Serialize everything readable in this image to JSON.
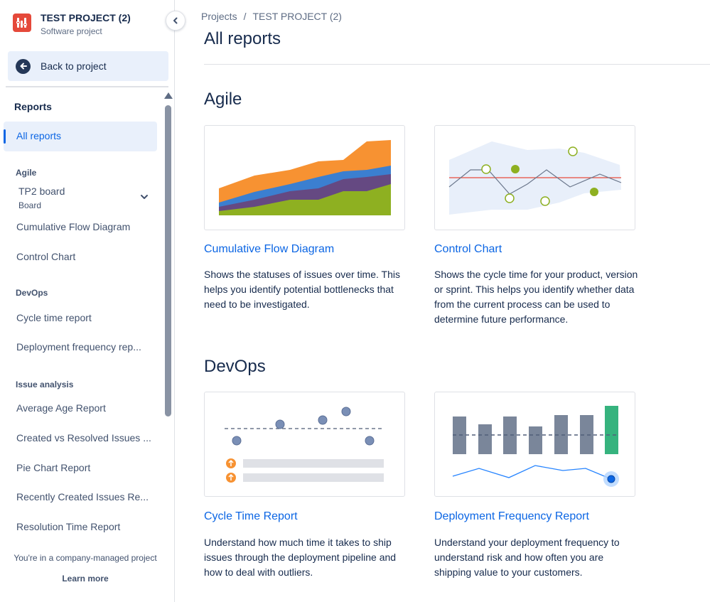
{
  "project": {
    "name": "TEST PROJECT (2)",
    "type": "Software project",
    "logo_color": "#e5493a"
  },
  "sidebar": {
    "back_label": "Back to project",
    "heading": "Reports",
    "active_item": "All reports",
    "groups": {
      "agile": "Agile",
      "devops": "DevOps",
      "issue_analysis": "Issue analysis"
    },
    "board": {
      "name": "TP2 board",
      "sub": "Board"
    },
    "agile_items": [
      "Cumulative Flow Diagram",
      "Control Chart"
    ],
    "devops_items": [
      "Cycle time report",
      "Deployment frequency rep..."
    ],
    "issue_items": [
      "Average Age Report",
      "Created vs Resolved Issues ...",
      "Pie Chart Report",
      "Recently Created Issues Re...",
      "Resolution Time Report"
    ],
    "footer_note": "You're in a company-managed project",
    "footer_link": "Learn more"
  },
  "breadcrumb": {
    "root": "Projects",
    "separator": "/",
    "current": "TEST PROJECT (2)"
  },
  "page_title": "All reports",
  "sections": {
    "agile": {
      "title": "Agile",
      "cards": [
        {
          "title": "Cumulative Flow Diagram",
          "desc": "Shows the statuses of issues over time. This helps you identify potential bottlenecks that need to be investigated."
        },
        {
          "title": "Control Chart",
          "desc": "Shows the cycle time for your product, version or sprint. This helps you identify whether data from the current process can be used to determine future performance."
        }
      ]
    },
    "devops": {
      "title": "DevOps",
      "cards": [
        {
          "title": "Cycle Time Report",
          "desc": "Understand how much time it takes to ship issues through the deployment pipeline and how to deal with outliers."
        },
        {
          "title": "Deployment Frequency Report",
          "desc": "Understand your deployment frequency to understand risk and how often you are shipping value to your customers."
        }
      ]
    }
  },
  "colors": {
    "accent": "#0c66e4",
    "active_bg": "#e9f0fb",
    "orange": "#f79232",
    "blue": "#3b7fd0",
    "purple": "#654982",
    "green": "#8eb021",
    "bar_gray": "#7a869a",
    "bar_green": "#36b37e"
  }
}
